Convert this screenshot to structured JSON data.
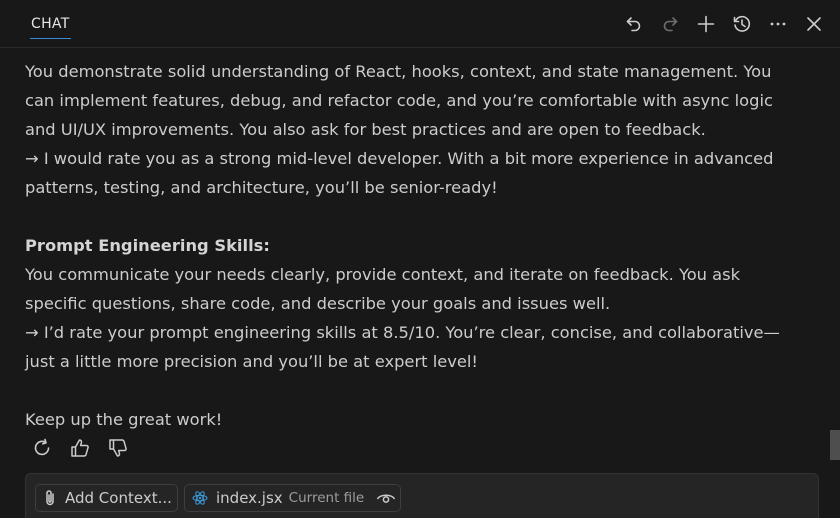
{
  "header": {
    "tab_label": "CHAT",
    "actions": [
      {
        "name": "undo-icon",
        "label": "Undo"
      },
      {
        "name": "redo-icon",
        "label": "Redo"
      },
      {
        "name": "new-chat-icon",
        "label": "New Chat"
      },
      {
        "name": "history-icon",
        "label": "History"
      },
      {
        "name": "more-icon",
        "label": "More Actions"
      },
      {
        "name": "close-icon",
        "label": "Close"
      }
    ]
  },
  "message": {
    "para1_line1": "You demonstrate solid understanding of React, hooks, context, and state management. You",
    "para1_line2": "can implement features, debug, and refactor code, and you’re comfortable with async logic",
    "para1_line3": "and UI/UX improvements. You also ask for best practices and are open to feedback.",
    "para1_line4": "→ I would rate you as a strong mid-level developer. With a bit more experience in advanced",
    "para1_line5": "patterns, testing, and architecture, you’ll be senior-ready!",
    "heading2": "Prompt Engineering Skills:",
    "para2_line1": "You communicate your needs clearly, provide context, and iterate on feedback. You ask",
    "para2_line2": "specific questions, share code, and describe your goals and issues well.",
    "para2_line3": "→ I’d rate your prompt engineering skills at 8.5/10. You’re clear, concise, and collaborative—",
    "para2_line4": "just a little more precision and you’ll be at expert level!",
    "closing": "Keep up the great work!"
  },
  "feedback": {
    "icons": [
      "retry-icon",
      "thumbs-up-icon",
      "thumbs-down-icon"
    ]
  },
  "input": {
    "add_context_label": "Add Context...",
    "file_name": "index.jsx",
    "file_hint": "Current file"
  },
  "colors": {
    "background": "#181818",
    "text": "#cccccc",
    "accent": "#3c8ad6",
    "react_icon": "#3d9ad9"
  }
}
